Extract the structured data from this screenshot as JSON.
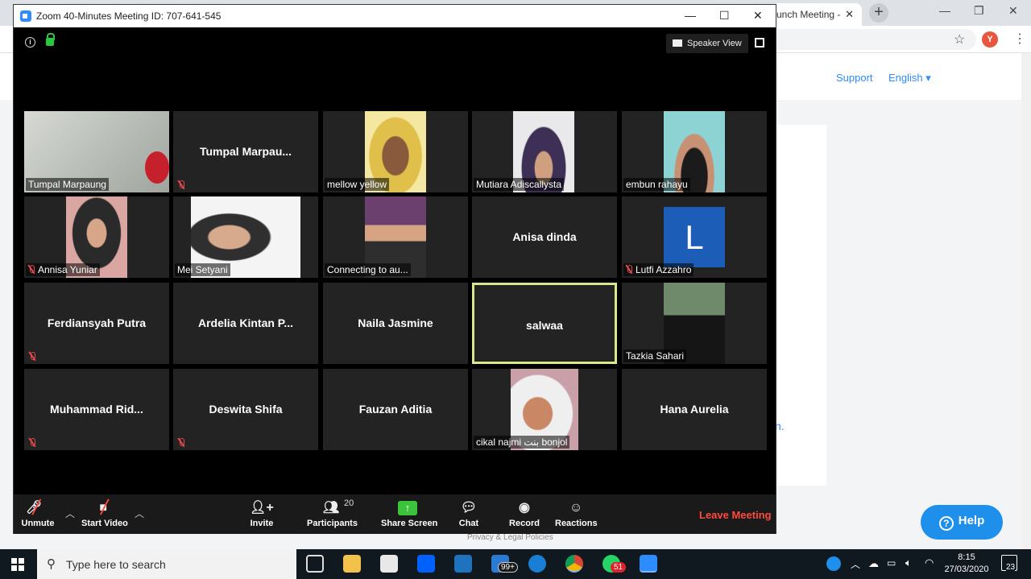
{
  "browser": {
    "tab_title": "unch Meeting -",
    "tab_close": "✕",
    "new_tab": "+",
    "profile_initial": "Y",
    "site_links": {
      "support": "Support",
      "language": "English ▾"
    },
    "fragment_text": "n.",
    "footer_link": "Privacy & Legal Policies",
    "help_button": "Help"
  },
  "zoom": {
    "title": "Zoom 40-Minutes Meeting ID: 707-641-545",
    "speaker_view": "Speaker View",
    "tiles": [
      {
        "label": "Tumpal Marpaung",
        "video": "board",
        "muted": false
      },
      {
        "name": "Tumpal  Marpau...",
        "video": null,
        "muted": true
      },
      {
        "label": "mellow yellow",
        "video": "face1",
        "muted": false
      },
      {
        "label": "Mutiara Adiscallysta",
        "video": "face4",
        "muted": false
      },
      {
        "label": "embun rahayu",
        "video": "face3",
        "muted": false
      },
      {
        "label": "Annisa Yuniar",
        "video": "face2",
        "muted": true
      },
      {
        "label": "Mei Setyani",
        "video": "face5",
        "muted": false
      },
      {
        "label": "Connecting to au...",
        "video": "face6",
        "muted": false
      },
      {
        "name": "Anisa dinda",
        "video": null,
        "muted": false
      },
      {
        "label": "Lutfi Azzahro",
        "avatar": "L",
        "muted": true
      },
      {
        "name": "Ferdiansyah Putra",
        "video": null,
        "muted": true
      },
      {
        "name": "Ardelia  Kintan  P...",
        "video": null,
        "muted": false
      },
      {
        "name": "Naila Jasmine",
        "video": null,
        "muted": false
      },
      {
        "name": "salwaa",
        "video": null,
        "muted": false,
        "active": true
      },
      {
        "label": "Tazkia Sahari",
        "video": "face7",
        "muted": false
      },
      {
        "name": "Muhammad  Rid...",
        "video": null,
        "muted": true
      },
      {
        "name": "Deswita Shifa",
        "video": null,
        "muted": true
      },
      {
        "name": "Fauzan Aditia",
        "video": null,
        "muted": false
      },
      {
        "label": "cikal najmi بنت bonjol",
        "video": "face8",
        "muted": false
      },
      {
        "name": "Hana Aurelia",
        "video": null,
        "muted": false
      }
    ],
    "toolbar": {
      "unmute": "Unmute",
      "start_video": "Start Video",
      "invite": "Invite",
      "participants": "Participants",
      "participant_count": "20",
      "share_screen": "Share Screen",
      "chat": "Chat",
      "record": "Record",
      "reactions": "Reactions",
      "leave": "Leave Meeting"
    }
  },
  "taskbar": {
    "search_placeholder": "Type here to search",
    "mail_badge": "99+",
    "whatsapp_badge": "51",
    "time": "8:15",
    "date": "27/03/2020",
    "notifications": "23"
  },
  "colors": {
    "zoom_blue": "#2d8cff",
    "active_speaker": "#d9e68a",
    "leave_red": "#ff4a3d",
    "share_green": "#3bc33c",
    "help_blue": "#1e8fea"
  }
}
